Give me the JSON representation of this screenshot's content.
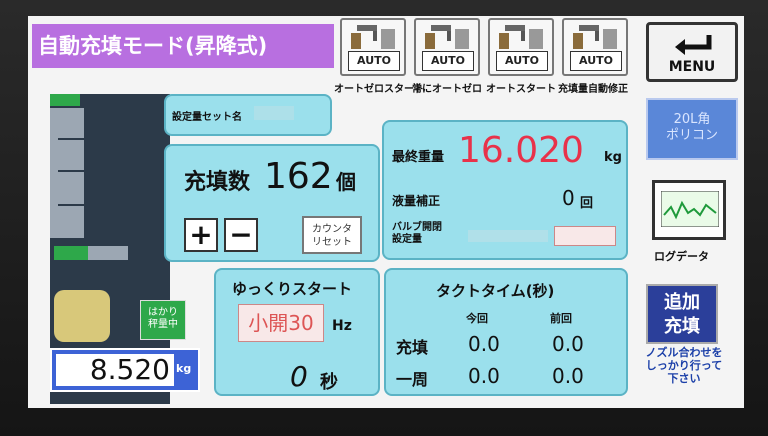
{
  "title": "自動充填モード(昇降式)",
  "auto_buttons": [
    {
      "caption": "AUTO",
      "label": "オートゼロスタート"
    },
    {
      "caption": "AUTO",
      "label": "常にオートゼロ"
    },
    {
      "caption": "AUTO",
      "label": "オートスタート"
    },
    {
      "caption": "AUTO",
      "label": "充填量自動修正"
    }
  ],
  "menu": {
    "label": "MENU"
  },
  "container": {
    "label": "20L角\nポリコン"
  },
  "log": {
    "label": "ログデータ"
  },
  "add_fill": {
    "label": "追加\n充填"
  },
  "nozzle_note": "ノズル合わせを\nしっかり行って\n下さい",
  "tank": {
    "weight_value": "8.520",
    "weight_unit": "kg",
    "status_label": "はかり\n秤量中"
  },
  "set_name": {
    "label": "設定量セット名"
  },
  "count": {
    "label": "充填数",
    "value": "162",
    "unit": "個",
    "plus": "+",
    "minus": "−",
    "reset": "カウンタ\nリセット"
  },
  "weight": {
    "final_label": "最終重量",
    "final_value": "16.020",
    "final_unit": "kg",
    "correction_label": "液量補正",
    "correction_value": "0",
    "correction_unit": "回",
    "valve_label": "バルブ開閉\n設定量"
  },
  "slow_start": {
    "label": "ゆっくりスタート",
    "freq_value": "小開30",
    "freq_unit": "Hz",
    "seconds_value": "0",
    "seconds_unit": "秒"
  },
  "takt": {
    "title": "タクトタイム(秒)",
    "col_this": "今回",
    "col_prev": "前回",
    "rows": [
      {
        "label": "充填",
        "this": "0.0",
        "prev": "0.0"
      },
      {
        "label": "一周",
        "this": "0.0",
        "prev": "0.0"
      }
    ]
  },
  "colors": {
    "title_bg": "#b86fe0",
    "panel_bg": "#9be0ec",
    "final_value": "#e8324a",
    "accent_blue": "#1b3fa8"
  }
}
